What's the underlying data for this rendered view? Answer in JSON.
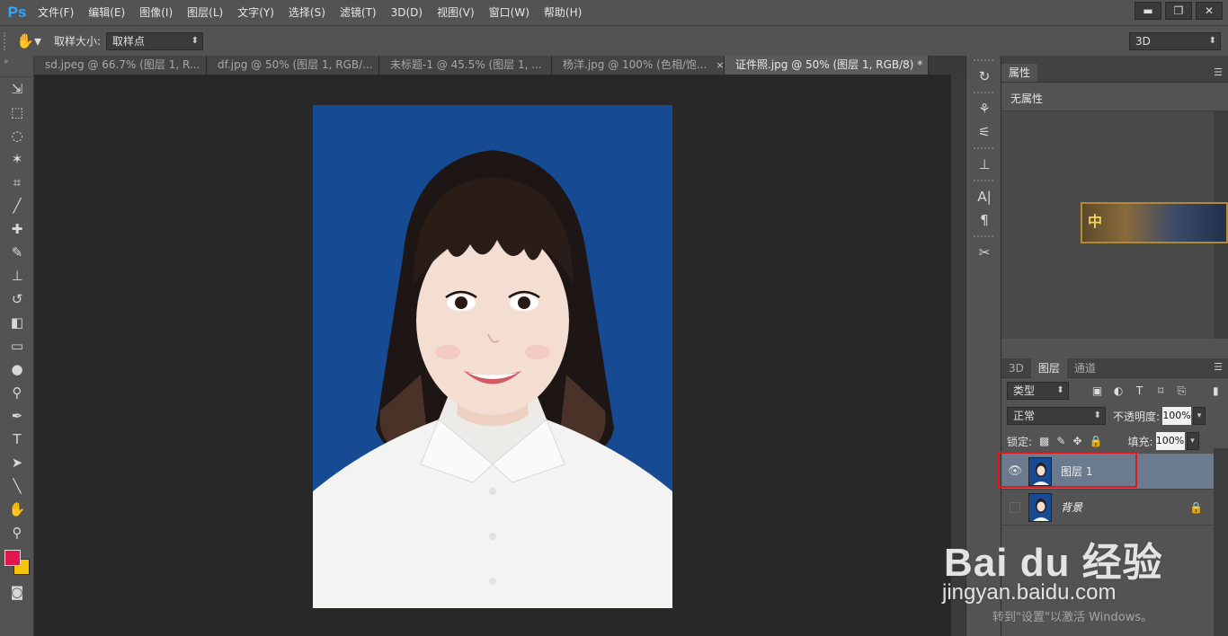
{
  "app": {
    "logo": "Ps"
  },
  "menu": [
    "文件(F)",
    "编辑(E)",
    "图像(I)",
    "图层(L)",
    "文字(Y)",
    "选择(S)",
    "滤镜(T)",
    "3D(D)",
    "视图(V)",
    "窗口(W)",
    "帮助(H)"
  ],
  "window_controls": {
    "minimize": "▬",
    "restore": "❐",
    "close": "✕"
  },
  "options": {
    "tool_icon": "hand-icon",
    "sample_label": "取样大小:",
    "sample_value": "取样点",
    "workspace_value": "3D"
  },
  "tabs": [
    {
      "label": "sd.jpeg @ 66.7% (图层 1, R...",
      "close": "×"
    },
    {
      "label": "df.jpg @ 50% (图层 1, RGB/...",
      "close": "×"
    },
    {
      "label": "未标题-1 @ 45.5% (图层 1, ...",
      "close": "×"
    },
    {
      "label": "杨洋.jpg @ 100% (色相/饱...",
      "close": "×"
    },
    {
      "label": "证件照.jpg @ 50% (图层 1, RGB/8) *",
      "close": "×"
    }
  ],
  "properties": {
    "tab": "属性",
    "empty": "无属性",
    "banner_text": "中"
  },
  "layers_panel": {
    "tabs": [
      "3D",
      "图层",
      "通道"
    ],
    "filter": "类型",
    "blend_mode": "正常",
    "opacity_label": "不透明度:",
    "opacity_value": "100%",
    "lock_label": "锁定:",
    "fill_label": "填充:",
    "fill_value": "100%",
    "layers": [
      {
        "name": "图层 1",
        "visible": true,
        "selected": true
      },
      {
        "name": "背景",
        "visible": false,
        "selected": false,
        "locked": true
      }
    ]
  },
  "watermark": {
    "logo": "Bai du 经验",
    "url": "jingyan.baidu.com"
  },
  "activation": {
    "text": "转到\"设置\"以激活 Windows。"
  },
  "colors": {
    "foreground": "#e0164d",
    "background": "#f8c300",
    "photo_bg": "#164a92",
    "highlight": "#e3161b"
  }
}
